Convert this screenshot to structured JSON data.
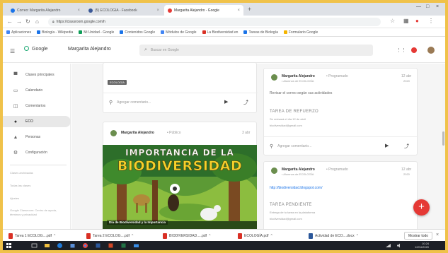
{
  "browser": {
    "tabs": [
      {
        "label": "Correo: Margarita Alejandro",
        "favicon_color": "#1a73e8",
        "active": false
      },
      {
        "label": "(5) ECOLOGÍA - Facebook",
        "favicon_color": "#3b5998",
        "active": false
      },
      {
        "label": "Margarita Alejandro - Google",
        "favicon_color": "#e53935",
        "active": true
      }
    ],
    "new_tab": "+",
    "url": "https://classroom.google.com/h",
    "bookmarks": [
      {
        "label": "Aplicaciones",
        "color": "#4285f4"
      },
      {
        "label": "Biología - Wikipedia",
        "color": "#1a73e8"
      },
      {
        "label": "Mi Unidad - Google",
        "color": "#0f9d58"
      },
      {
        "label": "Contenidos Google",
        "color": "#1a73e8"
      },
      {
        "label": "Módulos de Google",
        "color": "#4285f4"
      },
      {
        "label": "La Biodiversidad en",
        "color": "#d93025"
      },
      {
        "label": "Tareas de Biología",
        "color": "#1a73e8"
      },
      {
        "label": "Formulario Google",
        "color": "#f4b400"
      }
    ]
  },
  "app": {
    "brand": "Google",
    "user": "Margarita Alejandro",
    "search_placeholder": "Buscar en Google"
  },
  "sidebar": {
    "items": [
      {
        "label": "Clases principales",
        "icon": "home-icon"
      },
      {
        "label": "Calendario",
        "icon": "calendar-icon"
      },
      {
        "label": "Comentarios",
        "icon": "comment-icon"
      },
      {
        "label": "ECO",
        "icon": "class-icon"
      },
      {
        "label": "Personas",
        "icon": "people-icon"
      },
      {
        "label": "Configuración",
        "icon": "settings-icon"
      }
    ],
    "small_lines": [
      "Clases archivadas",
      "Todas las clases",
      "Ajustes",
      "Google Classroom: Centro de ayuda, términos y privacidad"
    ]
  },
  "feed_left": {
    "label_tag": "ECOLOGÍA",
    "comment_placeholder": "Agregar comentario...",
    "post": {
      "author": "Margarita Alejandro",
      "meta": "• Público",
      "date": "3 abr"
    },
    "banner": {
      "line1": "IMPORTANCIA DE LA",
      "line2": "BIODIVERSIDAD",
      "caption": "Día de Biodiversidad y la Importancia"
    }
  },
  "feed_right": {
    "post1": {
      "author": "Margarita Alejandro",
      "meta": "• Programado",
      "sub": "• Alumnos de ECOLOGÍA",
      "date": "12 abr",
      "date2": "2020",
      "body": "Revisar el correo según sus actividades",
      "section_title": "TAREA DE REFUERZO",
      "line1": "Se revisará el día 12 de abril",
      "line2": "biodiversidad@gmail.com",
      "comment_placeholder": "Agregar comentario..."
    },
    "post2": {
      "author": "Margarita Alejandro",
      "meta": "• Programado",
      "sub": "• Alumnos de ECOLOGÍA",
      "date": "12 abr",
      "date2": "2020",
      "link": "http://biodiversidad.blogspot.com/",
      "section_title": "TAREA PENDIENTE",
      "line1": "Entrega de tu tarea en la plataforma",
      "line2": "biodiversidad@gmail.com"
    }
  },
  "fab": "+",
  "downloads": {
    "items": [
      {
        "label": "Tarea 1 ECOLOG....pdf",
        "type": "pdf"
      },
      {
        "label": "Tarea 2 ECOLOG....pdf",
        "type": "pdf"
      },
      {
        "label": "BIODIVERSIDAD.....pdf",
        "type": "pdf"
      },
      {
        "label": "ECOLOGÍA.pdf",
        "type": "pdf"
      },
      {
        "label": "Actividad de ECO....docx",
        "type": "doc"
      }
    ],
    "show_all": "Mostrar todo",
    "close": "×"
  },
  "taskbar": {
    "time": "10:24",
    "date": "12/04/2020"
  }
}
